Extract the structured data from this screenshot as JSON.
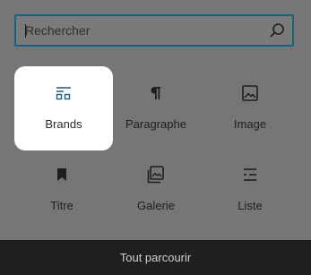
{
  "search": {
    "placeholder": "Rechercher",
    "icon": "search-icon"
  },
  "blocks": [
    {
      "label": "Brands",
      "icon": "brands-icon",
      "selected": true
    },
    {
      "label": "Paragraphe",
      "icon": "paragraph-icon",
      "selected": false
    },
    {
      "label": "Image",
      "icon": "image-icon",
      "selected": false
    },
    {
      "label": "Titre",
      "icon": "bookmark-heading-icon",
      "selected": false
    },
    {
      "label": "Galerie",
      "icon": "gallery-icon",
      "selected": false
    },
    {
      "label": "Liste",
      "icon": "list-icon",
      "selected": false
    }
  ],
  "footer": {
    "label": "Tout parcourir"
  },
  "colors": {
    "backdrop": "#767676",
    "search_border": "#17627f",
    "selected_background": "#ffffff",
    "footer_background": "#1f1f1f"
  }
}
